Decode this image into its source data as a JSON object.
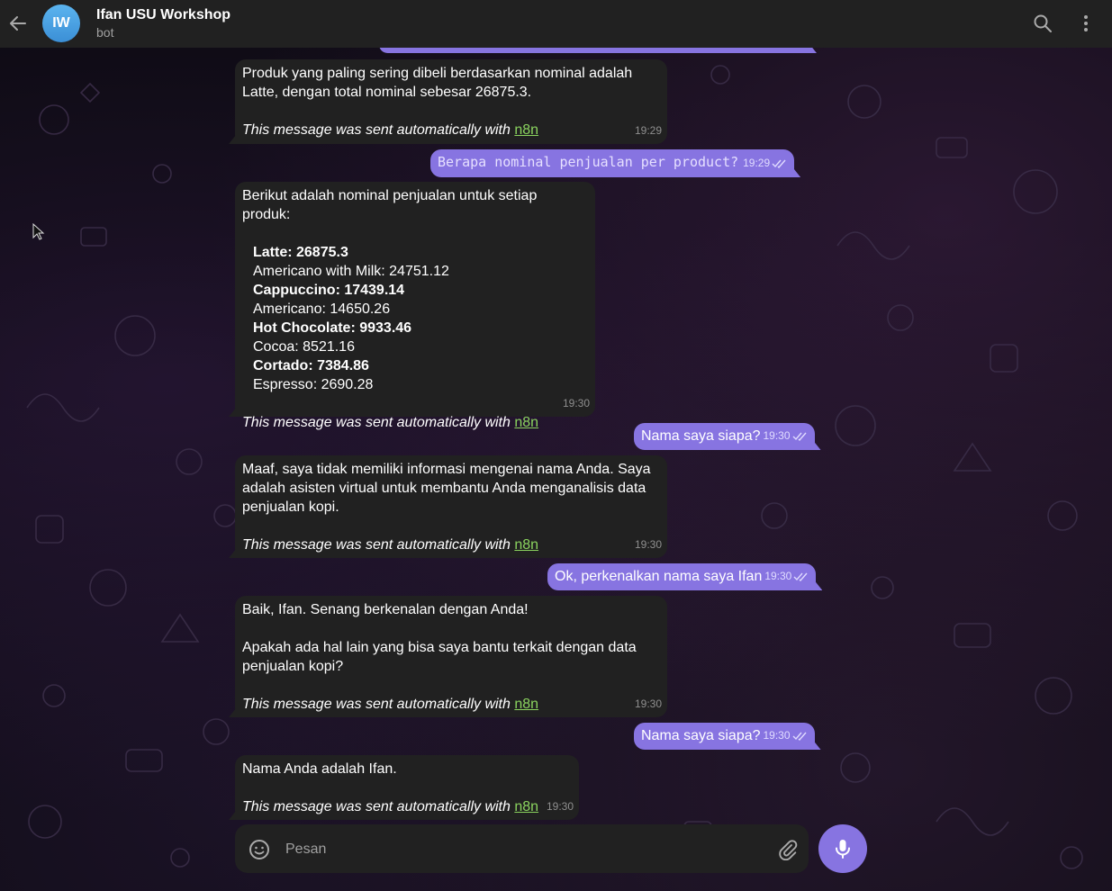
{
  "header": {
    "avatar_initials": "IW",
    "title": "Ifan USU Workshop",
    "subtitle": "bot"
  },
  "messages": [
    {
      "dir": "in",
      "lines": [
        "Produk yang paling sering dibeli berdasarkan nominal adalah",
        "Latte, dengan total nominal sebesar 26875.3."
      ],
      "auto_text": "This message was sent automatically with",
      "auto_link": "n8n",
      "time": "19:29"
    },
    {
      "dir": "out",
      "text": "Berapa nominal penjualan per product?",
      "time": "19:29"
    },
    {
      "dir": "in",
      "intro": "Berikut adalah nominal penjualan untuk setiap produk:",
      "items": [
        {
          "text": "Latte: 26875.3",
          "bold": true
        },
        {
          "text": "Americano with Milk: 24751.12",
          "bold": false
        },
        {
          "text": "Cappuccino: 17439.14",
          "bold": true
        },
        {
          "text": "Americano: 14650.26",
          "bold": false
        },
        {
          "text": "Hot Chocolate: 9933.46",
          "bold": true
        },
        {
          "text": "Cocoa: 8521.16",
          "bold": false
        },
        {
          "text": "Cortado: 7384.86",
          "bold": true
        },
        {
          "text": "Espresso: 2690.28",
          "bold": false
        }
      ],
      "auto_text": "This message was sent automatically with",
      "auto_link": "n8n",
      "time": "19:30"
    },
    {
      "dir": "out",
      "text": "Nama saya siapa?",
      "time": "19:30"
    },
    {
      "dir": "in",
      "lines": [
        "Maaf, saya tidak memiliki informasi mengenai nama Anda. Saya",
        "adalah asisten virtual untuk membantu Anda menganalisis data",
        "penjualan kopi."
      ],
      "auto_text": "This message was sent automatically with",
      "auto_link": "n8n",
      "time": "19:30"
    },
    {
      "dir": "out",
      "text": "Ok, perkenalkan nama saya Ifan",
      "time": "19:30"
    },
    {
      "dir": "in",
      "lines": [
        "Baik, Ifan. Senang berkenalan dengan Anda!"
      ],
      "lines2": [
        "Apakah ada hal lain yang bisa saya bantu terkait dengan data",
        "penjualan kopi?"
      ],
      "auto_text": "This message was sent automatically with",
      "auto_link": "n8n",
      "time": "19:30"
    },
    {
      "dir": "out",
      "text": "Nama saya siapa?",
      "time": "19:30"
    },
    {
      "dir": "in",
      "lines": [
        "Nama Anda adalah Ifan."
      ],
      "auto_text": "This message was sent automatically with",
      "auto_link": "n8n",
      "time": "19:30"
    }
  ],
  "composer": {
    "placeholder": "Pesan"
  },
  "icons": {
    "back": "arrow-left-icon",
    "search": "search-icon",
    "more": "more-vertical-icon",
    "emoji": "smile-icon",
    "attach": "paperclip-icon",
    "mic": "microphone-icon"
  },
  "colors": {
    "header_bg": "#212121",
    "incoming_bubble": "#212121",
    "outgoing_bubble": "#8774e1",
    "link": "#8bd45f",
    "avatar": "#4aa3e8"
  }
}
